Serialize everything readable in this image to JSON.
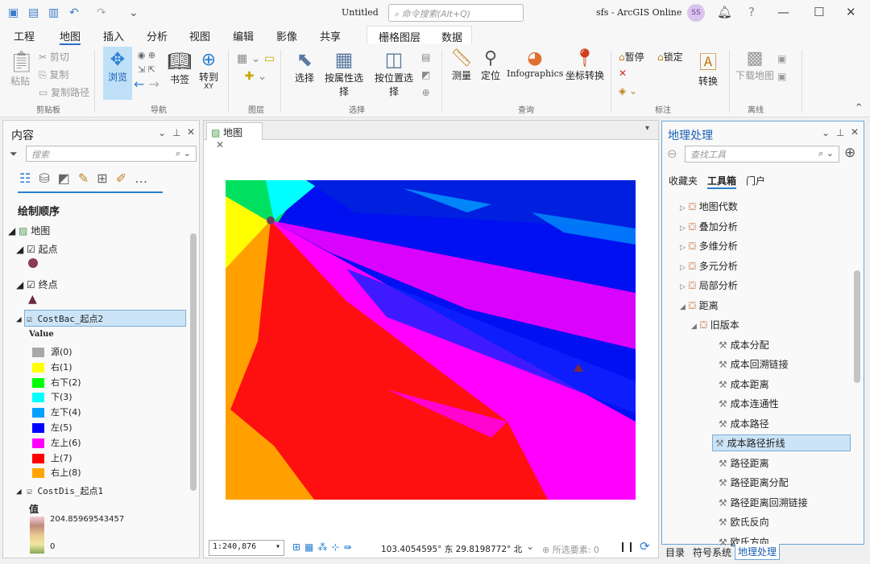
{
  "titlebar": {
    "doc_title": "Untitled",
    "search_placeholder": "命令搜索(Alt+Q)",
    "account": "sfs - ArcGIS Online",
    "avatar": "SS"
  },
  "tabs": [
    "工程",
    "地图",
    "插入",
    "分析",
    "视图",
    "编辑",
    "影像",
    "共享"
  ],
  "active_tab": "地图",
  "context_tabs": [
    "栅格图层",
    "数据"
  ],
  "ribbon": {
    "clipboard": {
      "paste": "粘贴",
      "cut": "剪切",
      "copy": "复制",
      "copy_path": "复制路径",
      "group": "剪贴板"
    },
    "navigate": {
      "explore": "浏览",
      "bookmarks": "书签",
      "goto": "转到",
      "goto_sub": "XY",
      "group": "导航"
    },
    "layer": {
      "group": "图层"
    },
    "selection": {
      "select": "选择",
      "by_attr": "按属性选择",
      "by_loc": "按位置选择",
      "group": "选择"
    },
    "inquiry": {
      "measure": "测量",
      "locate": "定位",
      "infographics": "Infographics",
      "convert_coords": "坐标转换",
      "group": "查询"
    },
    "labeling": {
      "pause": "暂停",
      "lock": "锁定",
      "convert": "转换",
      "group": "标注"
    },
    "offline": {
      "download": "下载地图",
      "group": "离线"
    }
  },
  "contents": {
    "title": "内容",
    "search_placeholder": "搜索",
    "drawing_order": "绘制顺序",
    "map": "地图",
    "layers": [
      {
        "name": "起点"
      },
      {
        "name": "终点"
      },
      {
        "name": "CostBac_起点2"
      },
      {
        "name": "CostDis_起点1"
      }
    ],
    "value_header": "Value",
    "legend": [
      {
        "label": "源(0)",
        "color": "#a8a8a8"
      },
      {
        "label": "右(1)",
        "color": "#ffff00"
      },
      {
        "label": "右下(2)",
        "color": "#00ff00"
      },
      {
        "label": "下(3)",
        "color": "#00ffff"
      },
      {
        "label": "左下(4)",
        "color": "#00a0ff"
      },
      {
        "label": "左(5)",
        "color": "#0000ff"
      },
      {
        "label": "左上(6)",
        "color": "#ff00ff"
      },
      {
        "label": "上(7)",
        "color": "#ff0000"
      },
      {
        "label": "右上(8)",
        "color": "#ffa500"
      }
    ],
    "dist_header": "值",
    "dist_max": "204.85969543457",
    "dist_min": "0"
  },
  "map": {
    "tab": "地图",
    "scale": "1:240,876",
    "coords": "103.4054595° 东 29.8198772° 北",
    "selected": "所选要素: 0"
  },
  "geo": {
    "title": "地理处理",
    "search_placeholder": "查找工具",
    "tabs": [
      "收藏夹",
      "工具箱",
      "门户"
    ],
    "active_tab": "工具箱",
    "items": [
      {
        "label": "地图代数",
        "level": 0,
        "type": "box"
      },
      {
        "label": "叠加分析",
        "level": 0,
        "type": "box"
      },
      {
        "label": "多维分析",
        "level": 0,
        "type": "box"
      },
      {
        "label": "多元分析",
        "level": 0,
        "type": "box"
      },
      {
        "label": "局部分析",
        "level": 0,
        "type": "box"
      },
      {
        "label": "距离",
        "level": 0,
        "type": "box",
        "open": true
      },
      {
        "label": "旧版本",
        "level": 1,
        "type": "box",
        "open": true
      },
      {
        "label": "成本分配",
        "level": 2,
        "type": "tool"
      },
      {
        "label": "成本回溯链接",
        "level": 2,
        "type": "tool"
      },
      {
        "label": "成本距离",
        "level": 2,
        "type": "tool"
      },
      {
        "label": "成本连通性",
        "level": 2,
        "type": "tool"
      },
      {
        "label": "成本路径",
        "level": 2,
        "type": "tool"
      },
      {
        "label": "成本路径折线",
        "level": 2,
        "type": "tool",
        "selected": true
      },
      {
        "label": "路径距离",
        "level": 2,
        "type": "tool"
      },
      {
        "label": "路径距离分配",
        "level": 2,
        "type": "tool"
      },
      {
        "label": "路径距离回溯链接",
        "level": 2,
        "type": "tool"
      },
      {
        "label": "欧氏反向",
        "level": 2,
        "type": "tool"
      },
      {
        "label": "欧氏方向",
        "level": 2,
        "type": "tool"
      }
    ],
    "bottom_tabs": [
      "目录",
      "符号系统",
      "地理处理"
    ],
    "bottom_active": "地理处理"
  }
}
